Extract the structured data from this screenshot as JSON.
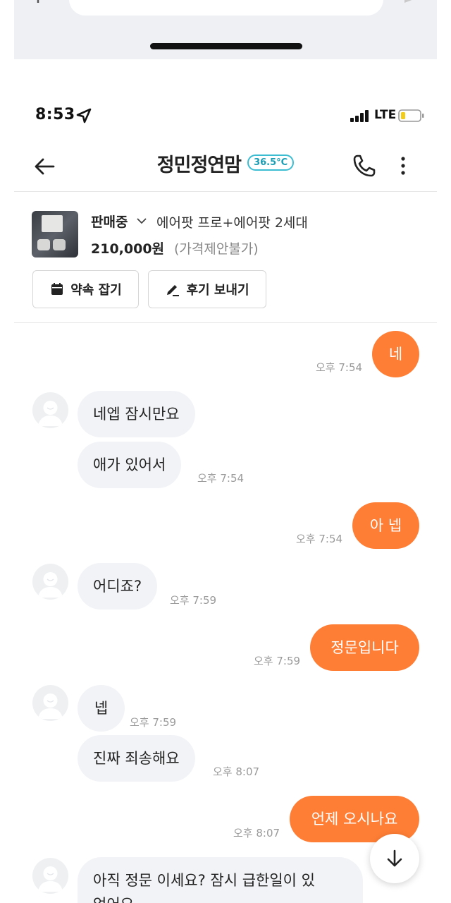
{
  "status_bar": {
    "time": "8:53",
    "network": "LTE"
  },
  "header": {
    "title": "정민정연맘",
    "manner_temp": "36.5°C"
  },
  "product": {
    "status": "판매중",
    "name": "에어팟 프로+에어팟 2세대",
    "price": "210,000원",
    "price_note": "(가격제안불가)",
    "appoint_label": "약속 잡기",
    "review_label": "후기 보내기"
  },
  "messages": [
    {
      "dir": "out",
      "text": "네",
      "time": "오후 7:54"
    },
    {
      "dir": "in",
      "text": "네엡 잠시만요"
    },
    {
      "dir": "in",
      "text": "애가 있어서",
      "time": "오후 7:54"
    },
    {
      "dir": "out",
      "text": "아 넵",
      "time": "오후 7:54"
    },
    {
      "dir": "in",
      "text": "어디죠?",
      "time": "오후 7:59"
    },
    {
      "dir": "out",
      "text": "정문입니다",
      "time": "오후 7:59"
    },
    {
      "dir": "in",
      "text": "넵",
      "time": "오후 7:59"
    },
    {
      "dir": "in",
      "text": "진짜 죄송해요",
      "time": "오후 8:07"
    },
    {
      "dir": "out",
      "text": "언제 오시나요",
      "time": "오후 8:07"
    },
    {
      "dir": "in",
      "text": "아직 정문 이세요? 잠시 급한일이 있",
      "text_line2": "었어요"
    }
  ],
  "colors": {
    "accent": "#ff7e35",
    "incoming_bubble": "#f2f3f6",
    "temp_badge": "#3dbdd1"
  }
}
